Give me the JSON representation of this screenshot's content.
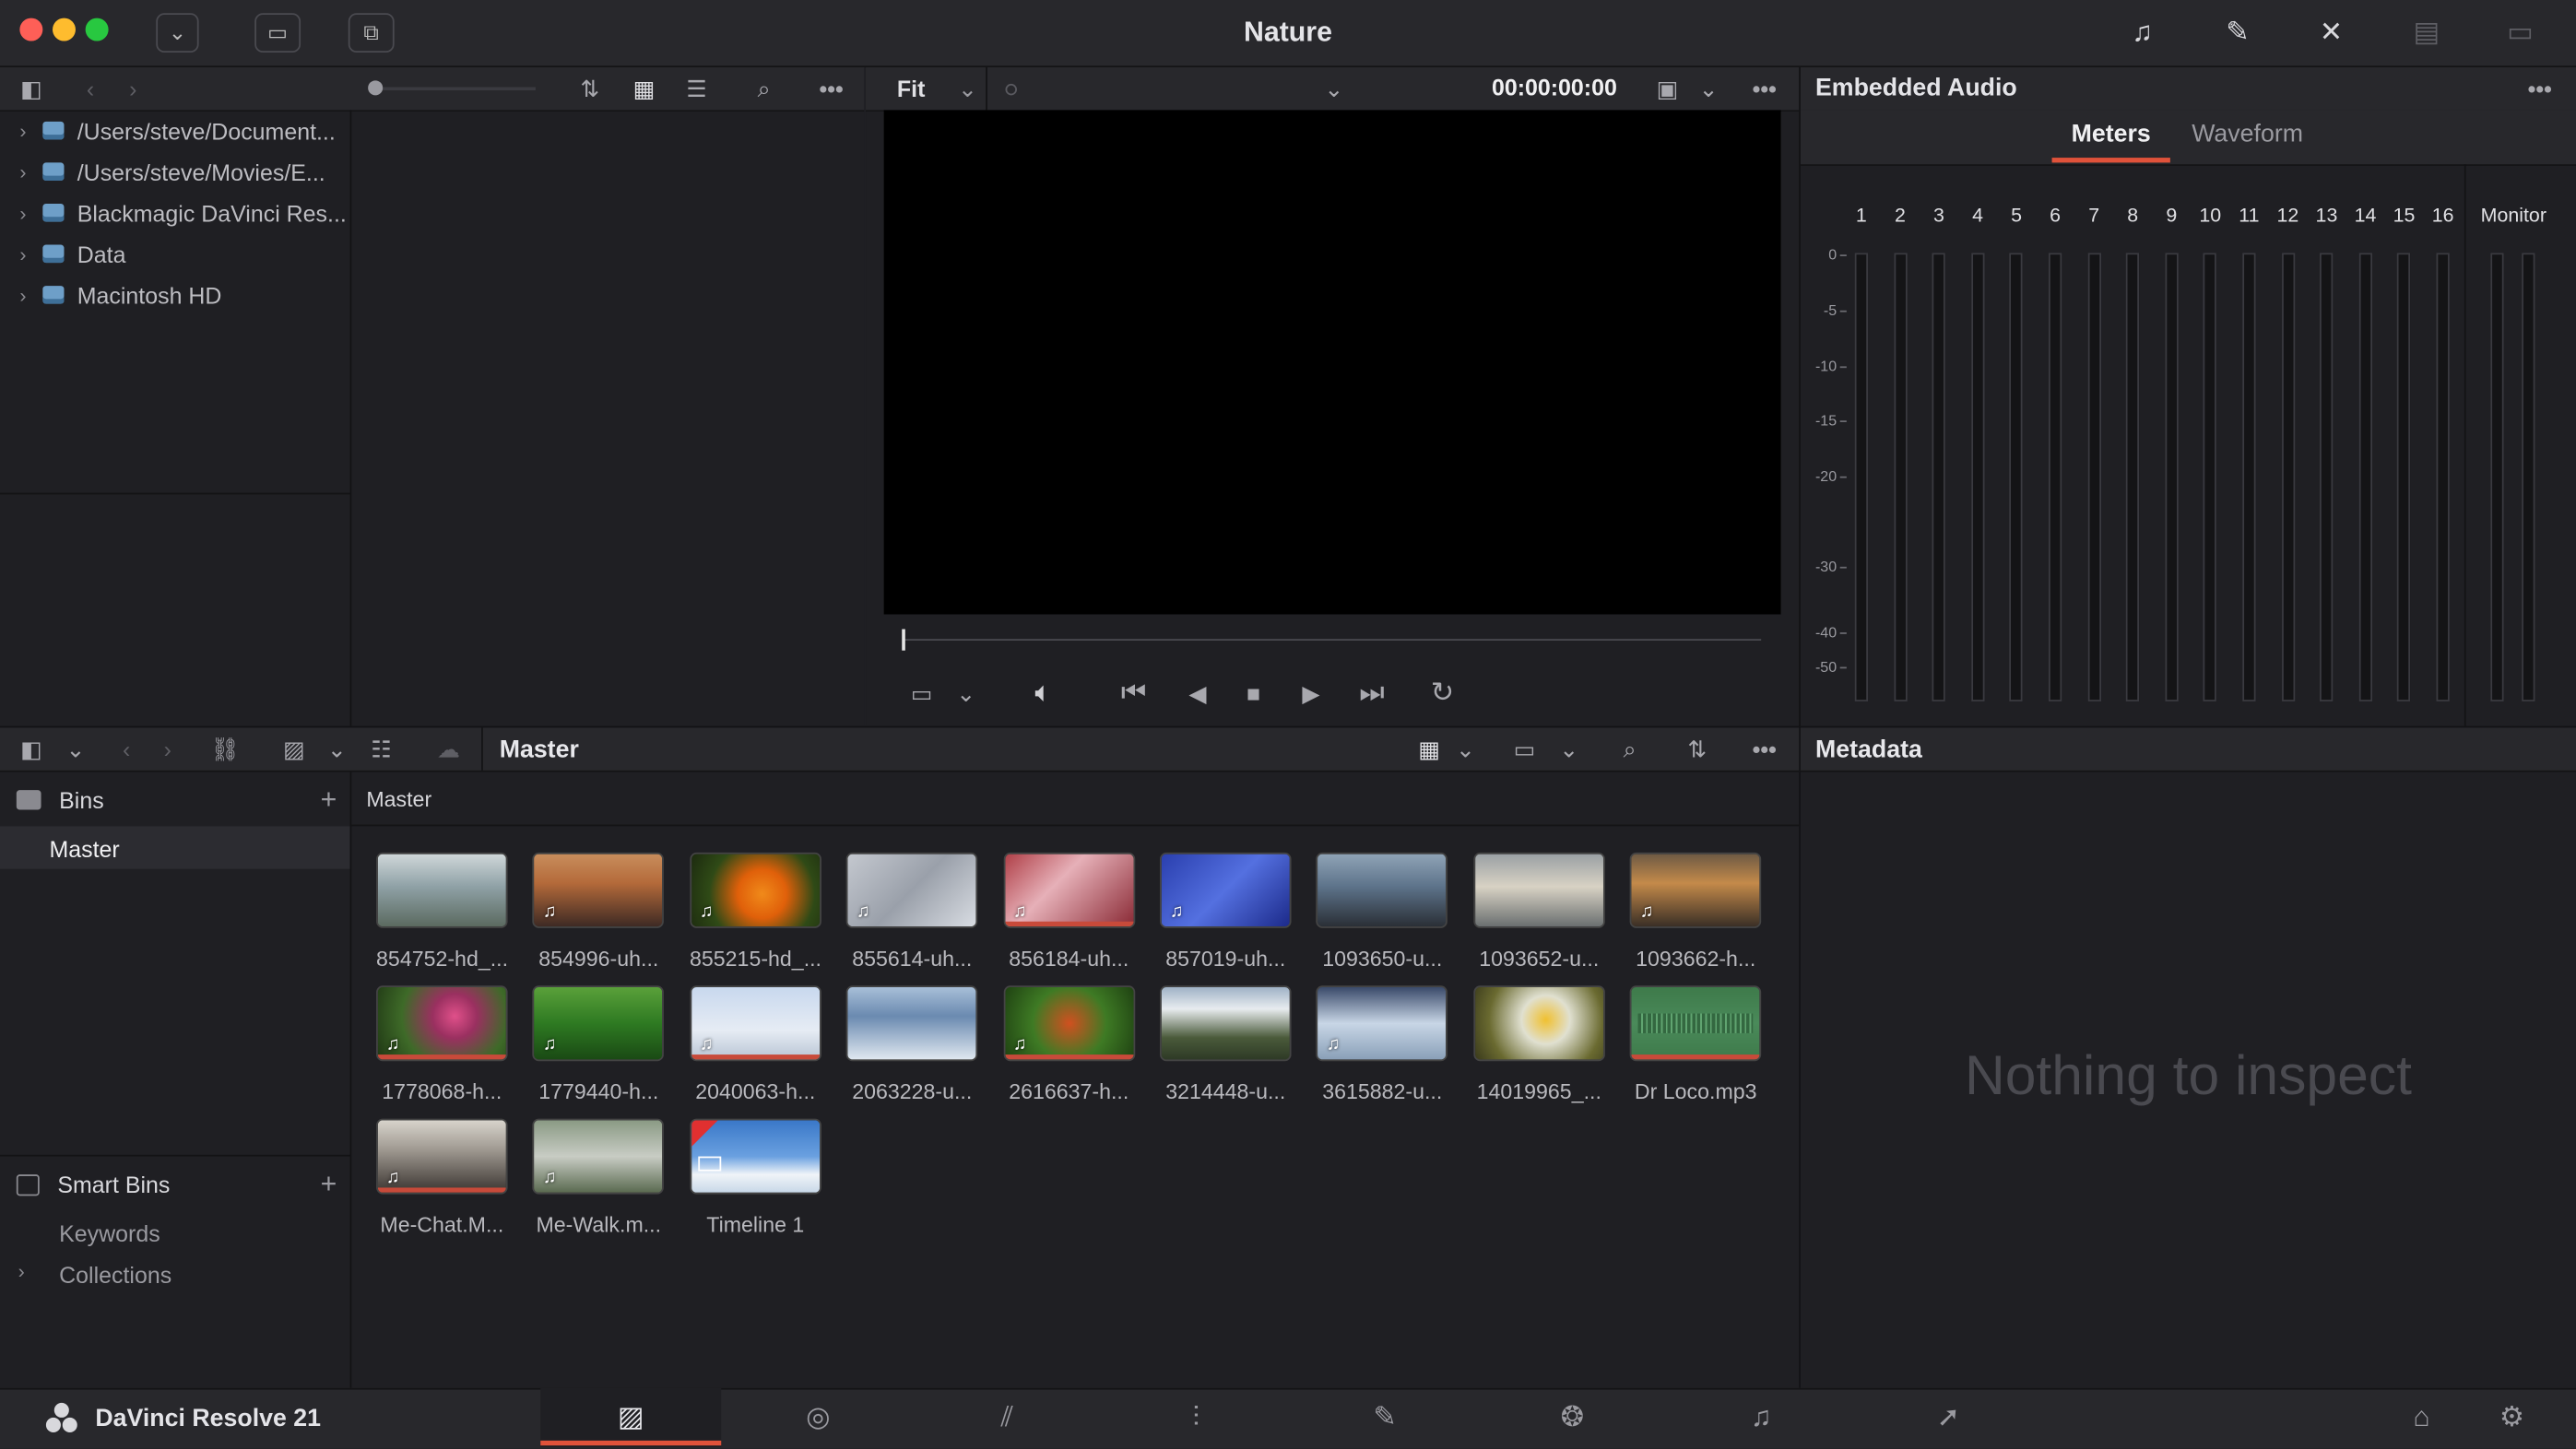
{
  "window": {
    "title": "Nature"
  },
  "media_storage": {
    "items": [
      {
        "label": "/Users/steve/Document..."
      },
      {
        "label": "/Users/steve/Movies/E..."
      },
      {
        "label": "Blackmagic DaVinci Res..."
      },
      {
        "label": "Data"
      },
      {
        "label": "Macintosh HD"
      }
    ]
  },
  "viewer": {
    "zoom": "Fit",
    "timecode": "00:00:00:00"
  },
  "audio": {
    "title": "Embedded Audio",
    "tabs": [
      {
        "label": "Meters",
        "active": true
      },
      {
        "label": "Waveform",
        "active": false
      }
    ],
    "channels": [
      "1",
      "2",
      "3",
      "4",
      "5",
      "6",
      "7",
      "8",
      "9",
      "10",
      "11",
      "12",
      "13",
      "14",
      "15",
      "16"
    ],
    "monitor_label": "Monitor",
    "scale": [
      "0",
      "-5",
      "-10",
      "-15",
      "-20",
      "-30",
      "-40",
      "-50"
    ]
  },
  "media_pool": {
    "title": "Master",
    "breadcrumb": "Master",
    "bins_label": "Bins",
    "bins": [
      {
        "label": "Master",
        "selected": true
      }
    ],
    "smart_bins_label": "Smart Bins",
    "smart_bins": [
      {
        "label": "Keywords"
      },
      {
        "label": "Collections"
      }
    ],
    "clips": [
      {
        "name": "854752-hd_...",
        "audio": false,
        "redline": false,
        "gradient": "linear-gradient(180deg,#cfd7d9 0%,#8fa1a6 45%,#5b6a60 100%)"
      },
      {
        "name": "854996-uh...",
        "audio": true,
        "redline": false,
        "gradient": "linear-gradient(180deg,#c88d5c 0%,#b46a3a 40%,#3e2a24 100%)"
      },
      {
        "name": "855215-hd_...",
        "audio": true,
        "redline": false,
        "gradient": "radial-gradient(circle at 55% 55%,#f08a1a 0%,#e0600a 30%,#2f4a16 65%,#1c2a0f 100%)"
      },
      {
        "name": "855614-uh...",
        "audio": true,
        "redline": false,
        "gradient": "linear-gradient(135deg,#c4c8cf 0%,#9aa0aa 50%,#d8dce2 100%)"
      },
      {
        "name": "856184-uh...",
        "audio": true,
        "redline": true,
        "gradient": "linear-gradient(135deg,#b04048 0%,#e6b0b8 40%,#8a2a35 100%)"
      },
      {
        "name": "857019-uh...",
        "audio": true,
        "redline": false,
        "gradient": "linear-gradient(135deg,#2a3fae 0%,#5470e0 50%,#1c2a8a 100%)"
      },
      {
        "name": "1093650-u...",
        "audio": false,
        "redline": false,
        "gradient": "linear-gradient(180deg,#8fa3b6 0%,#5d738a 45%,#2a2f36 100%)"
      },
      {
        "name": "1093652-u...",
        "audio": false,
        "redline": false,
        "gradient": "linear-gradient(180deg,#9aa0a4 0%,#d8d2c4 45%,#6a6f70 100%)"
      },
      {
        "name": "1093662-h...",
        "audio": true,
        "redline": false,
        "gradient": "linear-gradient(180deg,#6e5a44 0%,#c48a4a 40%,#3a2f26 100%)"
      },
      {
        "name": "1778068-h...",
        "audio": true,
        "redline": true,
        "gradient": "radial-gradient(circle at 60% 40%,#e0508a 0%,#9a3060 25%,#3e6a28 60%,#1f3614 100%)"
      },
      {
        "name": "1779440-h...",
        "audio": true,
        "redline": false,
        "gradient": "linear-gradient(180deg,#5aa03a 0%,#2e7a22 50%,#1a4a14 100%)"
      },
      {
        "name": "2040063-h...",
        "audio": true,
        "redline": true,
        "gradient": "linear-gradient(180deg,#c8d8ee 0%,#e6ecf4 60%,#b8c4d4 100%)"
      },
      {
        "name": "2063228-u...",
        "audio": false,
        "redline": false,
        "gradient": "linear-gradient(180deg,#a8bfd8 0%,#6a8ab0 40%,#e0e8f0 100%)"
      },
      {
        "name": "2616637-h...",
        "audio": true,
        "redline": true,
        "gradient": "radial-gradient(circle at 50% 50%,#d05020 0%,#3e7a24 50%,#1f4212 100%)"
      },
      {
        "name": "3214448-u...",
        "audio": false,
        "redline": false,
        "gradient": "linear-gradient(180deg,#9fb2c6 0%,#e8ecef 30%,#4a5a3a 70%,#2e3a26 100%)"
      },
      {
        "name": "3615882-u...",
        "audio": true,
        "redline": false,
        "gradient": "linear-gradient(180deg,#3a4a6a 0%,#c8d6e6 50%,#8aa0b8 100%)"
      },
      {
        "name": "14019965_...",
        "audio": false,
        "redline": false,
        "gradient": "radial-gradient(circle at 55% 45%,#f0c030 0%,#e0e0d0 30%,#6a6a30 70%,#3a3a1c 100%)"
      },
      {
        "name": "Dr Loco.mp3",
        "audio": false,
        "redline": true,
        "waveform": true,
        "gradient": "linear-gradient(180deg,#3e7a4a 0%,#4a8a5a 50%,#3e7a4a 100%)"
      },
      {
        "name": "Me-Chat.M...",
        "audio": true,
        "redline": true,
        "gradient": "linear-gradient(180deg,#d8d4cc 0%,#a09a92 40%,#3a3430 100%)"
      },
      {
        "name": "Me-Walk.m...",
        "audio": true,
        "redline": false,
        "gradient": "linear-gradient(180deg,#8a9a84 0%,#c8ccc4 50%,#5a6a50 100%)"
      },
      {
        "name": "Timeline 1",
        "audio": false,
        "redline": false,
        "timeline": true,
        "gradient": "linear-gradient(180deg,#3a78c8 0%,#6aa0e0 50%,#f0f4f8 75%,#c8d8e8 100%)"
      }
    ]
  },
  "metadata": {
    "title": "Metadata",
    "empty_text": "Nothing to inspect"
  },
  "app": {
    "name": "DaVinci Resolve 21"
  },
  "colors": {
    "accent": "#e0523a",
    "bg": "#1f1f23",
    "toolbar": "#28282c"
  }
}
